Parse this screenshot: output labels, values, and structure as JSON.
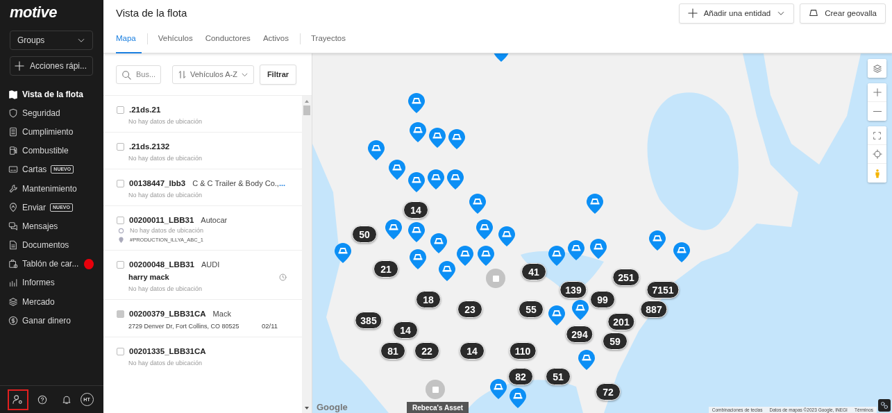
{
  "sidebar": {
    "logo": "motive",
    "groups": {
      "label": "Groups"
    },
    "quick_actions": {
      "label": "Acciones rápi..."
    },
    "items": [
      {
        "label": "Vista de la flota",
        "selected": true
      },
      {
        "label": "Seguridad",
        "selected": false
      },
      {
        "label": "Cumplimiento",
        "selected": false
      },
      {
        "label": "Combustible",
        "selected": false
      },
      {
        "label": "Cartas",
        "selected": false,
        "badge": "NUEVO"
      },
      {
        "label": "Mantenimiento",
        "selected": false
      },
      {
        "label": "Enviar",
        "selected": false,
        "badge": "NUEVO"
      },
      {
        "label": "Mensajes",
        "selected": false
      },
      {
        "label": "Documentos",
        "selected": false
      },
      {
        "label": "Tablón de car...",
        "selected": false,
        "notification": true
      },
      {
        "label": "Informes",
        "selected": false
      },
      {
        "label": "Mercado",
        "selected": false
      },
      {
        "label": "Ganar dinero",
        "selected": false
      }
    ],
    "footer": {
      "settings_highlighted": true,
      "avatar": "HT"
    }
  },
  "header": {
    "title": "Vista de la flota",
    "add_button": "Añadir una entidad",
    "geofence_button": "Crear geovalla"
  },
  "tabs": [
    {
      "label": "Mapa",
      "selected": true
    },
    {
      "label": "Vehículos",
      "selected": false
    },
    {
      "label": "Conductores",
      "selected": false
    },
    {
      "label": "Activos",
      "selected": false
    },
    {
      "label": "Trayectos",
      "selected": false
    }
  ],
  "list": {
    "search": {
      "placeholder": "Bus..."
    },
    "sort": "Vehículos A-Z",
    "filter": "Filtrar",
    "rows": [
      {
        "name": ".21ds.21",
        "disabled": false,
        "location": "No hay datos de ubicación"
      },
      {
        "name": ".21ds.2132",
        "disabled": false,
        "location": "No hay datos de ubicación"
      },
      {
        "name": "00138447_lbb3",
        "disabled": false,
        "make": "C & C Trailer & Body Co.,",
        "more": "...",
        "location": "No hay datos de ubicación"
      },
      {
        "name": "00200011_LBB31",
        "disabled": false,
        "make": "Autocar",
        "location": "No hay datos de ubicación",
        "tag": "#PRODUCTION_ILLYA_ABC_1"
      },
      {
        "name": "00200048_LBB31",
        "disabled": false,
        "make": "AUDI",
        "driver": "harry mack",
        "clock": true,
        "location": "No hay datos de ubicación"
      },
      {
        "name": "00200379_LBB31CA",
        "disabled": true,
        "make": "Mack",
        "location": "2729 Denver Dr, Fort Collins, CO 80525",
        "date": "02/11"
      },
      {
        "name": "00201335_LBB31CA",
        "disabled": false,
        "location": "No hay datos de ubicación"
      }
    ]
  },
  "map": {
    "clusters": [
      "14",
      "50",
      "21",
      "41",
      "251",
      "139",
      "7151",
      "18",
      "99",
      "23",
      "55",
      "887",
      "385",
      "201",
      "14",
      "294",
      "59",
      "81",
      "22",
      "14",
      "110",
      "82",
      "51",
      "72"
    ],
    "asset_label": "Rebeca's Asset",
    "google": "Google",
    "attribution": [
      "Combinaciones de teclas",
      "Datos de mapas ©2023 Google, INEGI",
      "Términos"
    ]
  }
}
